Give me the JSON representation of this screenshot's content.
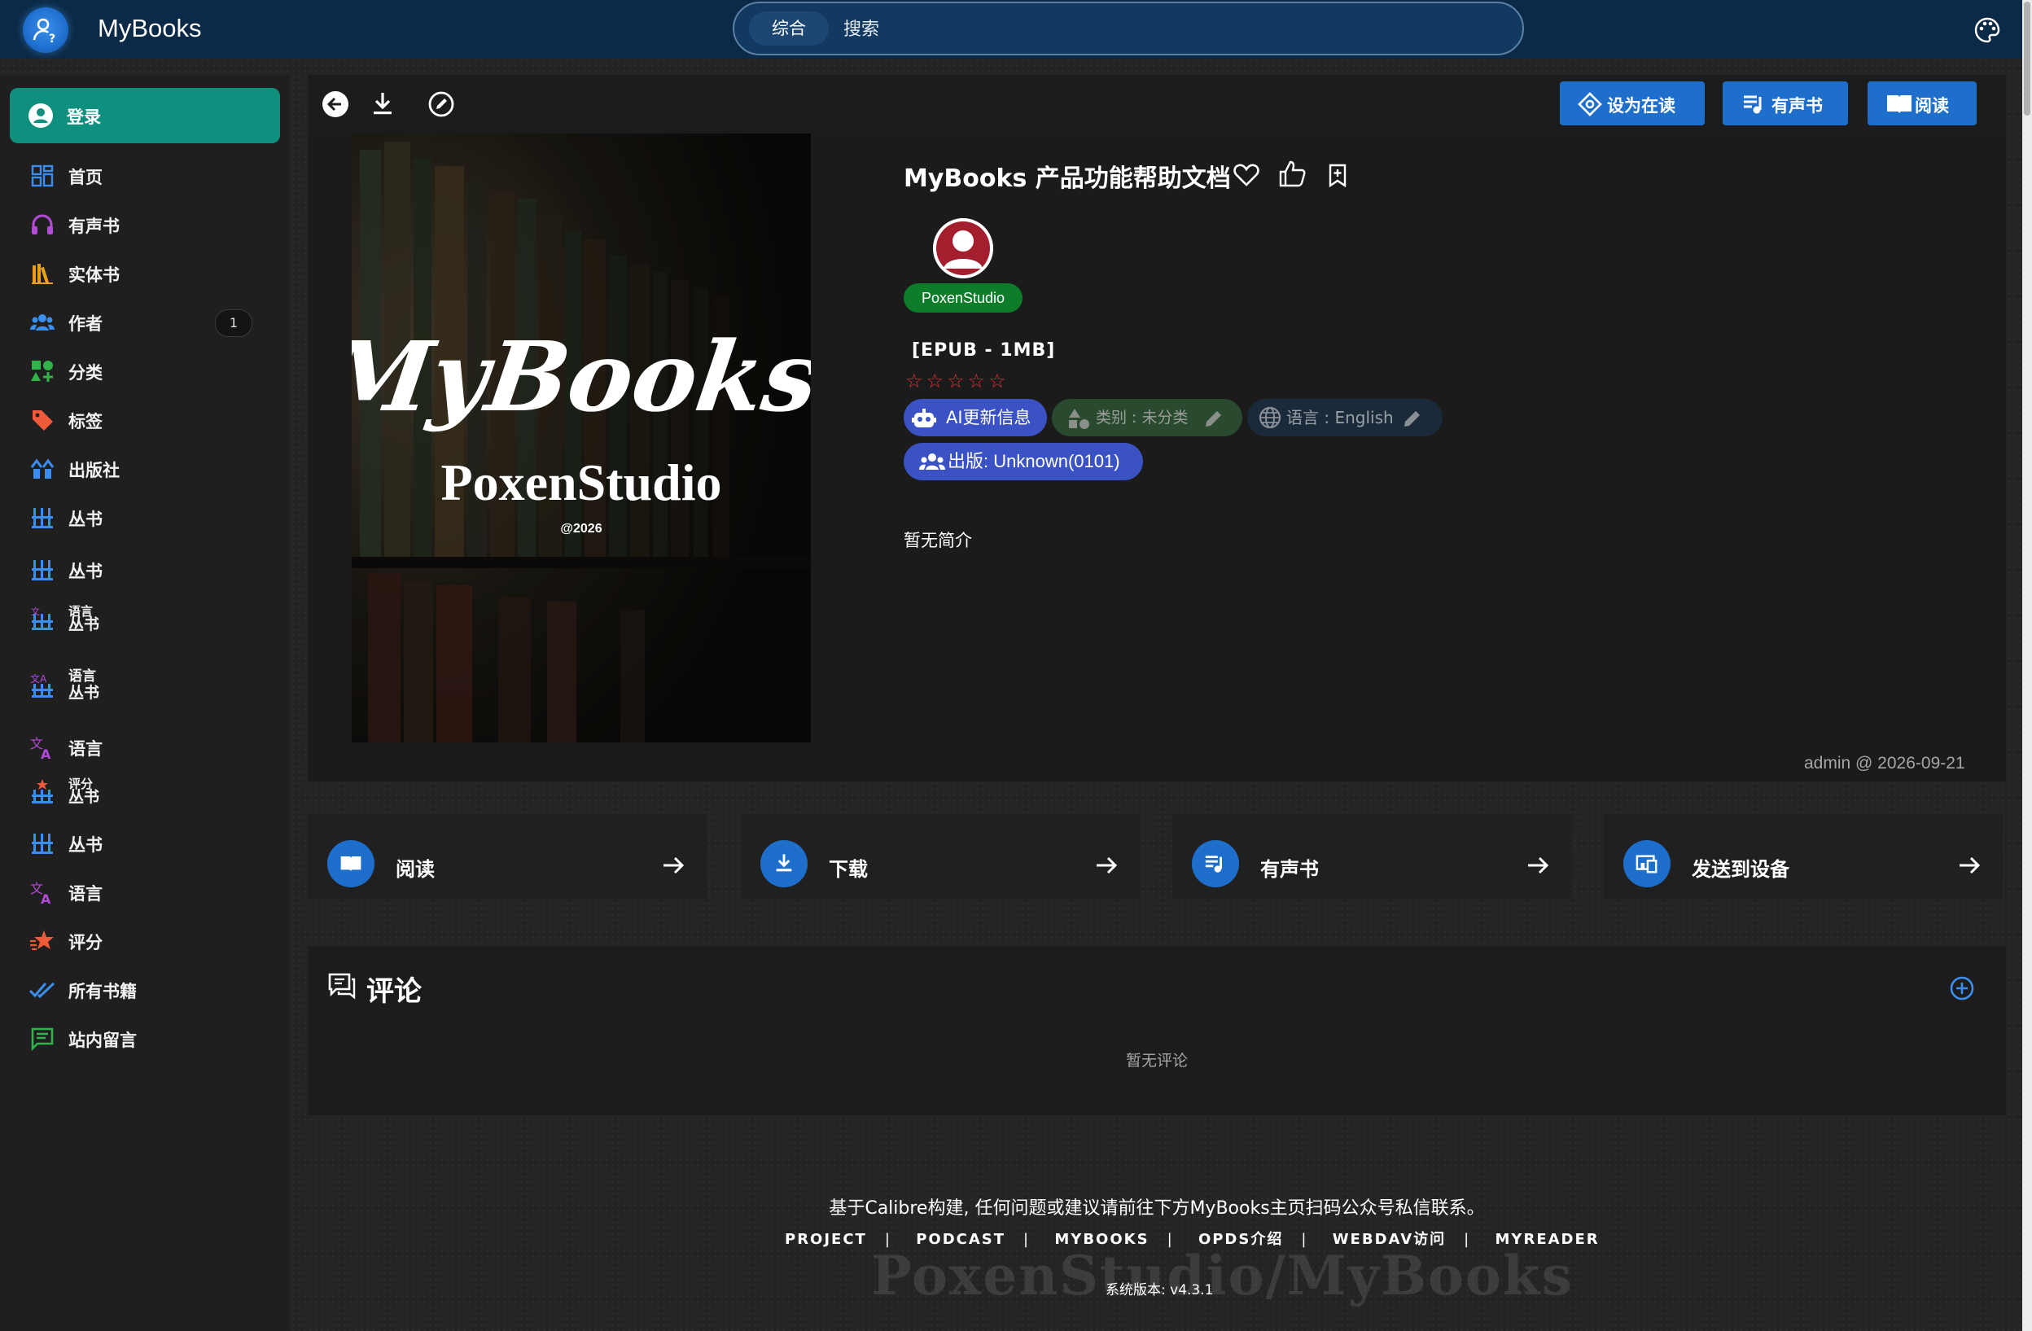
{
  "app": {
    "title": "MyBooks"
  },
  "search": {
    "scope_label": "综合",
    "placeholder": "搜索"
  },
  "sidebar": {
    "login_label": "登录",
    "items": [
      {
        "label": "首页",
        "icon": "grid-icon"
      },
      {
        "label": "有声书",
        "icon": "headphones-icon"
      },
      {
        "label": "实体书",
        "icon": "books-icon"
      },
      {
        "label": "作者",
        "icon": "people-icon",
        "badge": "1"
      },
      {
        "label": "分类",
        "icon": "shapes-icon"
      },
      {
        "label": "标签",
        "icon": "tag-icon"
      },
      {
        "label": "出版社",
        "icon": "publisher-icon"
      },
      {
        "label": "丛书",
        "icon": "series-icon"
      },
      {
        "label": "丛书",
        "icon": "series-icon"
      },
      {
        "label_top": "语言",
        "label": "丛书",
        "icon": "series-language-icon"
      },
      {
        "label_top": "语言",
        "label": "丛书",
        "icon": "translate-series-icon"
      },
      {
        "label": "语言",
        "icon": "translate-icon"
      },
      {
        "label_top": "评分",
        "label": "丛书",
        "icon": "series-rating-icon"
      },
      {
        "label": "丛书",
        "icon": "series-icon"
      },
      {
        "label": "语言",
        "icon": "translate-icon"
      },
      {
        "label": "评分",
        "icon": "star-icon"
      },
      {
        "label": "所有书籍",
        "icon": "double-check-icon"
      },
      {
        "label": "站内留言",
        "icon": "message-icon"
      }
    ]
  },
  "toolbar": {
    "set_reading_label": "设为在读",
    "audiobook_label": "有声书",
    "read_label": "阅读"
  },
  "book": {
    "cover": {
      "title": "MyBooks",
      "subtitle": "PoxenStudio",
      "year": "@2026"
    },
    "title": "MyBooks 产品功能帮助文档",
    "author": "PoxenStudio",
    "format": "[EPUB - 1MB]",
    "rating": {
      "stars_filled": 0,
      "stars_total": 5,
      "display": "☆☆☆☆☆"
    },
    "ai_update_label": "AI更新信息",
    "category_label": "类别 : 未分类",
    "language_label": "语言 : English",
    "publisher_label": "出版:  Unknown(0101)",
    "summary": "暂无简介",
    "stamp": "admin @ 2026-09-21"
  },
  "quick_actions": [
    {
      "label": "阅读",
      "icon": "book-open-icon"
    },
    {
      "label": "下载",
      "icon": "download-icon"
    },
    {
      "label": "有声书",
      "icon": "playlist-icon"
    },
    {
      "label": "发送到设备",
      "icon": "devices-icon"
    }
  ],
  "comments": {
    "title": "评论",
    "empty_text": "暂无评论"
  },
  "footer": {
    "text": "基于Calibre构建, 任何问题或建议请前往下方MyBooks主页扫码公众号私信联系。",
    "links": [
      "PROJECT",
      "PODCAST",
      "MYBOOKS",
      "OPDS介绍",
      "WEBDAV访问",
      "MYREADER"
    ],
    "watermark": "PoxenStudio/MyBooks",
    "version": "系统版本: v4.3.1"
  },
  "colors": {
    "topbar": "#0b2a47",
    "accent_blue": "#1e6fcb",
    "login_green": "#0f8f7e",
    "author_green": "#0e7d2a",
    "ai_purple": "#3b52c4",
    "star_red": "#e0303a"
  }
}
